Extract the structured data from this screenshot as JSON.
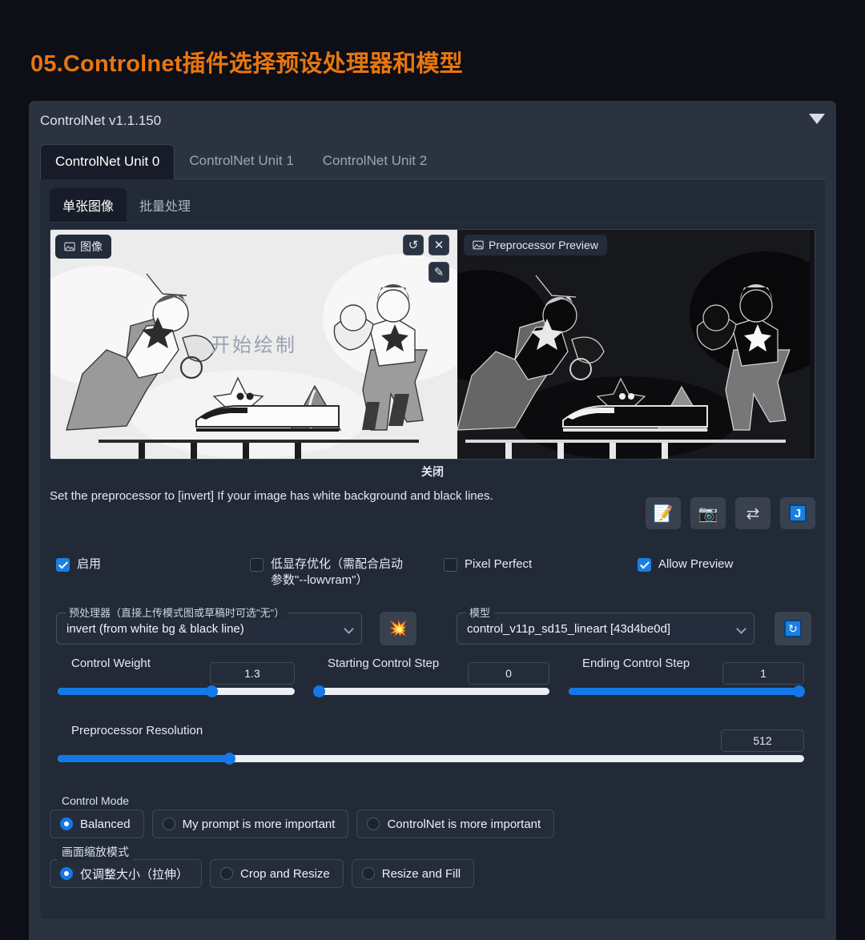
{
  "page": {
    "title": "05.Controlnet插件选择预设处理器和模型",
    "accent_color": "#e8760f",
    "background": "#0d0e16"
  },
  "panel": {
    "version_label": "ControlNet v1.1.150",
    "collapse_icon": "chevron-down-icon",
    "unit_tabs": [
      {
        "label": "ControlNet Unit 0",
        "active": true
      },
      {
        "label": "ControlNet Unit 1",
        "active": false
      },
      {
        "label": "ControlNet Unit 2",
        "active": false
      }
    ],
    "sub_tabs": [
      {
        "label": "单张图像",
        "active": true
      },
      {
        "label": "批量处理",
        "active": false
      }
    ]
  },
  "image_area": {
    "left_chip": "图像",
    "right_chip": "Preprocessor Preview",
    "watermark": "开始绘制",
    "close_label": "关闭",
    "buttons": [
      {
        "name": "undo-icon",
        "glyph": "↺"
      },
      {
        "name": "close-icon",
        "glyph": "✕"
      },
      {
        "name": "pen-icon",
        "glyph": "✎"
      }
    ]
  },
  "hint": {
    "text": "Set the preprocessor to [invert] If your image has white background and black lines.",
    "tools": [
      {
        "name": "edit-note-button",
        "glyph": "📝"
      },
      {
        "name": "camera-button",
        "glyph": "📷"
      },
      {
        "name": "swap-button",
        "glyph": "⇄"
      },
      {
        "name": "upload-j-button",
        "glyph": "J"
      }
    ]
  },
  "checkboxes": [
    {
      "label": "启用",
      "checked": true
    },
    {
      "label": "低显存优化（需配合启动参数\"--lowvram\"）",
      "checked": false
    },
    {
      "label": "Pixel Perfect",
      "checked": false
    },
    {
      "label": "Allow Preview",
      "checked": true
    }
  ],
  "preprocessor": {
    "label": "预处理器（直接上传模式图或草稿时可选\"无\"）",
    "value": "invert (from white bg & black line)",
    "run_button_icon": "explosion-icon",
    "run_button_glyph": "💥"
  },
  "model": {
    "label": "模型",
    "value": "control_v11p_sd15_lineart [43d4be0d]",
    "refresh_button_icon": "refresh-icon",
    "refresh_button_glyph": "↻"
  },
  "sliders": [
    {
      "name": "control-weight",
      "label": "Control Weight",
      "value": "1.3",
      "percent": 65
    },
    {
      "name": "starting-control-step",
      "label": "Starting Control Step",
      "value": "0",
      "percent": 0
    },
    {
      "name": "ending-control-step",
      "label": "Ending Control Step",
      "value": "1",
      "percent": 100
    },
    {
      "name": "preprocessor-resolution",
      "label": "Preprocessor Resolution",
      "value": "512",
      "percent": 23
    }
  ],
  "control_mode": {
    "label": "Control Mode",
    "options": [
      {
        "label": "Balanced",
        "selected": true
      },
      {
        "label": "My prompt is more important",
        "selected": false
      },
      {
        "label": "ControlNet is more important",
        "selected": false
      }
    ]
  },
  "resize_mode": {
    "label": "画面缩放模式",
    "options": [
      {
        "label": "仅调整大小（拉伸）",
        "selected": true
      },
      {
        "label": "Crop and Resize",
        "selected": false
      },
      {
        "label": "Resize and Fill",
        "selected": false
      }
    ]
  }
}
